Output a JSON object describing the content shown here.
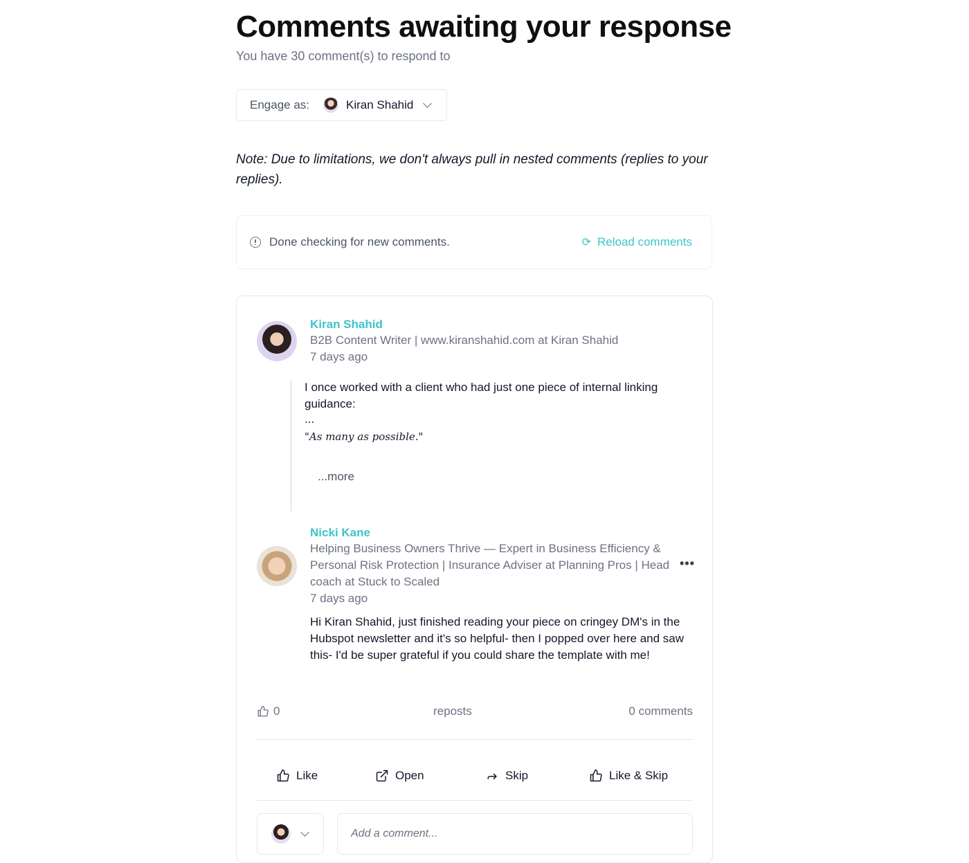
{
  "header": {
    "title": "Comments awaiting your response",
    "subtitle": "You have 30 comment(s) to respond to"
  },
  "engage": {
    "label": "Engage as:",
    "selected_user": "Kiran Shahid"
  },
  "note": "Note: Due to limitations, we don't always pull in nested comments (replies to your replies).",
  "status": {
    "message": "Done checking for new comments.",
    "reload_label": "Reload comments",
    "accent_color": "#3cc5cc"
  },
  "post": {
    "author": "Kiran Shahid",
    "headline": "B2B Content Writer | www.kiranshahid.com at Kiran Shahid",
    "time": "7 days ago",
    "text": "I once worked with a client who had just one piece of internal linking guidance:",
    "ellipsis": "...",
    "quote": "\"As many as possible.\"",
    "more_label": "...more"
  },
  "comment": {
    "author": "Nicki Kane",
    "headline": "Helping Business Owners Thrive — Expert in Business Efficiency & Personal Risk Protection | Insurance Adviser at Planning Pros | Head coach at Stuck to Scaled",
    "time": "7 days ago",
    "text": "Hi Kiran Shahid, just finished reading your piece on cringey DM's in the Hubspot newsletter and it's so helpful- then I popped over here and saw this- I'd be super grateful if you could share the template with me!",
    "menu_icon": "more-horizontal-icon"
  },
  "stats": {
    "likes": "0",
    "reposts": "reposts",
    "comments": "0 comments"
  },
  "actions": {
    "like": "Like",
    "open": "Open",
    "skip": "Skip",
    "like_skip": "Like & Skip"
  },
  "composer": {
    "placeholder": "Add a comment..."
  }
}
